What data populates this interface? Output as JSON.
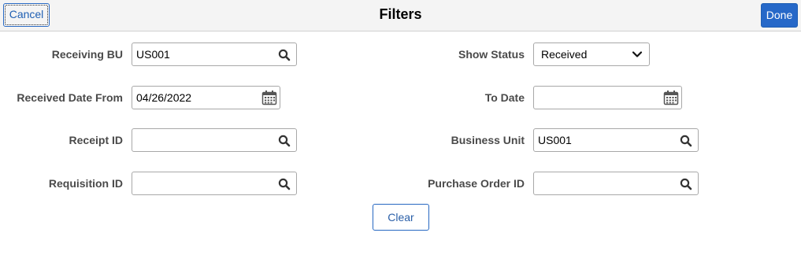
{
  "header": {
    "title": "Filters",
    "cancel_label": "Cancel",
    "done_label": "Done"
  },
  "filters": {
    "receiving_bu": {
      "label": "Receiving BU",
      "value": "US001",
      "icon": "search-icon"
    },
    "show_status": {
      "label": "Show Status",
      "value": "Received",
      "icon": "chevron-down-icon"
    },
    "received_date_from": {
      "label": "Received Date From",
      "value": "04/26/2022",
      "icon": "calendar-icon"
    },
    "to_date": {
      "label": "To Date",
      "value": "",
      "icon": "calendar-icon"
    },
    "receipt_id": {
      "label": "Receipt ID",
      "value": "",
      "icon": "search-icon"
    },
    "business_unit": {
      "label": "Business Unit",
      "value": "US001",
      "icon": "search-icon"
    },
    "requisition_id": {
      "label": "Requisition ID",
      "value": "",
      "icon": "search-icon"
    },
    "purchase_order_id": {
      "label": "Purchase Order ID",
      "value": "",
      "icon": "search-icon"
    }
  },
  "actions": {
    "clear_label": "Clear"
  },
  "colors": {
    "accent": "#2668c8",
    "header_bg": "#f4f4f4",
    "label": "#4a4a4a"
  }
}
